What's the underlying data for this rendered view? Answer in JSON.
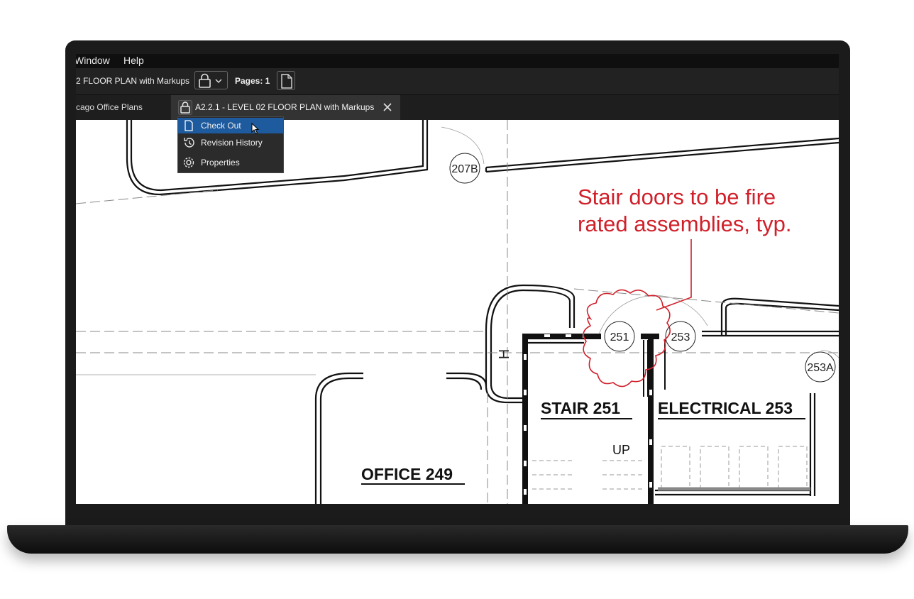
{
  "menubar": {
    "items": [
      "Window",
      "Help"
    ]
  },
  "toolbar": {
    "doc_title": "2 FLOOR PLAN with Markups",
    "pages_label": "Pages: 1"
  },
  "tabs": {
    "project": "cago Office Plans",
    "active_label": "A2.2.1 - LEVEL 02 FLOOR PLAN with Markups"
  },
  "context_menu": {
    "items": [
      {
        "label": "Check Out",
        "icon": "document-icon",
        "highlighted": true
      },
      {
        "label": "Revision History",
        "icon": "history-icon",
        "highlighted": false
      },
      {
        "label": "Properties",
        "icon": "gear-icon",
        "highlighted": false
      }
    ]
  },
  "drawing": {
    "tags": [
      "207B",
      "251",
      "253",
      "253A"
    ],
    "rooms": {
      "stair": "STAIR  251",
      "electrical": "ELECTRICAL  253",
      "office": "OFFICE  249",
      "up": "UP"
    },
    "markup": {
      "line1": "Stair doors to be fire",
      "line2": "rated assemblies, typ.",
      "color": "#d0202a"
    }
  },
  "colors": {
    "highlight": "#1e5a9e",
    "menubar": "#0f0f0f",
    "toolbar": "#222222"
  }
}
